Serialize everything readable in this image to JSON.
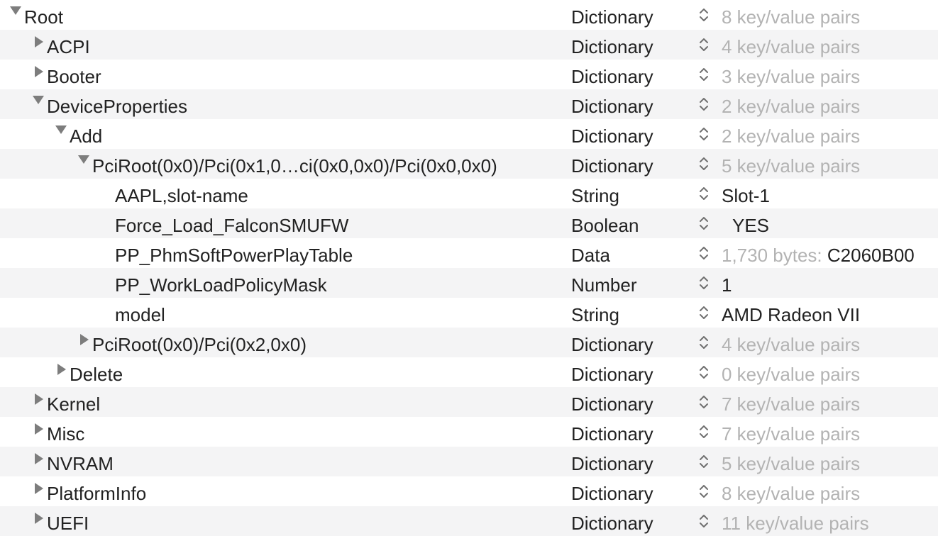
{
  "rows": [
    {
      "key": "Root",
      "level": 0,
      "disclosure": "down",
      "type": "Dictionary",
      "value": "8 key/value pairs",
      "value_style": "dim"
    },
    {
      "key": "ACPI",
      "level": 1,
      "disclosure": "right",
      "type": "Dictionary",
      "value": "4 key/value pairs",
      "value_style": "dim"
    },
    {
      "key": "Booter",
      "level": 1,
      "disclosure": "right",
      "type": "Dictionary",
      "value": "3 key/value pairs",
      "value_style": "dim"
    },
    {
      "key": "DeviceProperties",
      "level": 1,
      "disclosure": "down",
      "type": "Dictionary",
      "value": "2 key/value pairs",
      "value_style": "dim"
    },
    {
      "key": "Add",
      "level": 2,
      "disclosure": "down",
      "type": "Dictionary",
      "value": "2 key/value pairs",
      "value_style": "dim"
    },
    {
      "key": "PciRoot(0x0)/Pci(0x1,0…ci(0x0,0x0)/Pci(0x0,0x0)",
      "level": 3,
      "disclosure": "down",
      "type": "Dictionary",
      "value": "5 key/value pairs",
      "value_style": "dim"
    },
    {
      "key": "AAPL,slot-name",
      "level": 4,
      "disclosure": "none",
      "type": "String",
      "value": "Slot-1",
      "value_style": "dark"
    },
    {
      "key": "Force_Load_FalconSMUFW",
      "level": 4,
      "disclosure": "none",
      "type": "Boolean",
      "value": "YES",
      "value_style": "bool"
    },
    {
      "key": "PP_PhmSoftPowerPlayTable",
      "level": 4,
      "disclosure": "none",
      "type": "Data",
      "value_prefix": "1,730 bytes: ",
      "value": "C2060B00",
      "value_style": "data"
    },
    {
      "key": "PP_WorkLoadPolicyMask",
      "level": 4,
      "disclosure": "none",
      "type": "Number",
      "value": "1",
      "value_style": "dark"
    },
    {
      "key": "model",
      "level": 4,
      "disclosure": "none",
      "type": "String",
      "value": "AMD Radeon VII",
      "value_style": "dark"
    },
    {
      "key": "PciRoot(0x0)/Pci(0x2,0x0)",
      "level": 3,
      "disclosure": "right",
      "type": "Dictionary",
      "value": "4 key/value pairs",
      "value_style": "dim"
    },
    {
      "key": "Delete",
      "level": 2,
      "disclosure": "right",
      "type": "Dictionary",
      "value": "0 key/value pairs",
      "value_style": "dim"
    },
    {
      "key": "Kernel",
      "level": 1,
      "disclosure": "right",
      "type": "Dictionary",
      "value": "7 key/value pairs",
      "value_style": "dim"
    },
    {
      "key": "Misc",
      "level": 1,
      "disclosure": "right",
      "type": "Dictionary",
      "value": "7 key/value pairs",
      "value_style": "dim"
    },
    {
      "key": "NVRAM",
      "level": 1,
      "disclosure": "right",
      "type": "Dictionary",
      "value": "5 key/value pairs",
      "value_style": "dim"
    },
    {
      "key": "PlatformInfo",
      "level": 1,
      "disclosure": "right",
      "type": "Dictionary",
      "value": "8 key/value pairs",
      "value_style": "dim"
    },
    {
      "key": "UEFI",
      "level": 1,
      "disclosure": "right",
      "type": "Dictionary",
      "value": "11 key/value pairs",
      "value_style": "dim"
    }
  ],
  "icons": {
    "disclosure_expanded": "triangle-down-icon",
    "disclosure_collapsed": "triangle-right-icon",
    "type_popup": "up-down-chevron-icon"
  },
  "colors": {
    "text": "#222222",
    "dim_value": "#b3b3b3",
    "alt_row": "#f4f4f5",
    "triangle": "#7d7d7d"
  }
}
